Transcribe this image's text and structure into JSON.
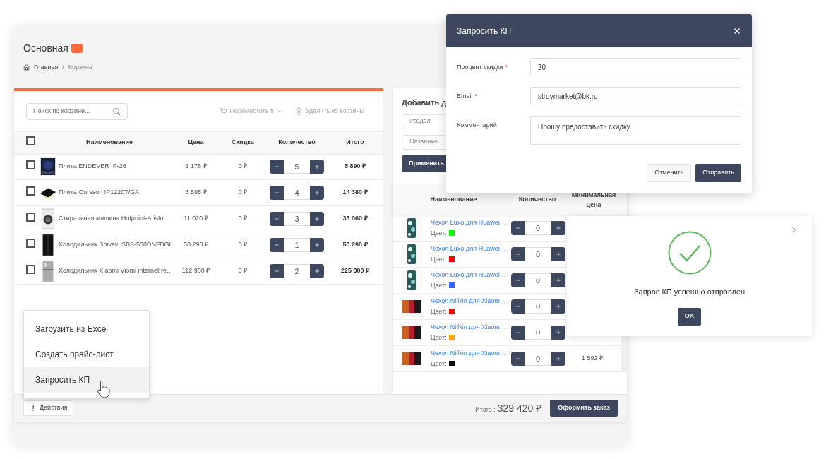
{
  "page": {
    "title": "Основная",
    "breadcrumb": [
      {
        "label": "Главная",
        "kind": "home"
      },
      {
        "label": "/",
        "kind": "separator"
      },
      {
        "label": "Корзина",
        "kind": "current"
      }
    ]
  },
  "cart": {
    "search": {
      "placeholder": "Поиск по корзине..."
    },
    "actions": [
      {
        "label": "Переместить в",
        "kind": "move",
        "disabled": true
      },
      {
        "label": "Удалить из корзины",
        "kind": "delete",
        "disabled": true
      }
    ],
    "select_all": {
      "checked": false
    },
    "columns": [
      "Наименование",
      "Цена",
      "Скидка",
      "Количество",
      "Итого"
    ],
    "rows": [
      {
        "name": "Плита ENDEVER IP-26",
        "price": "1 178 ₽",
        "discount": "0 ₽",
        "qty": "5",
        "total": "5 890 ₽",
        "checked": false
      },
      {
        "name": "Плита Oursson IP1220T/GA",
        "price": "3 595 ₽",
        "discount": "0 ₽",
        "qty": "4",
        "total": "14 380 ₽",
        "checked": false
      },
      {
        "name": "Стиральная машина Hotpoint-Aristo…",
        "price": "11 020 ₽",
        "discount": "0 ₽",
        "qty": "3",
        "total": "33 060 ₽",
        "checked": false
      },
      {
        "name": "Холодильник Shivaki SBS-550DNFBGI",
        "price": "50 290 ₽",
        "discount": "0 ₽",
        "qty": "1",
        "total": "50 290 ₽",
        "checked": false
      },
      {
        "name": "Холодильник Xiaomi Viomi internet re…",
        "price": "112 900 ₽",
        "discount": "0 ₽",
        "qty": "2",
        "total": "225 800 ₽",
        "checked": false
      }
    ]
  },
  "add": {
    "title": "Добавить д",
    "fields": [
      {
        "placeholder": "Раздел"
      },
      {
        "placeholder": "Название"
      }
    ],
    "apply": "Применить",
    "columns": [
      "Наименование",
      "Количество",
      "Минимальная цена"
    ],
    "rows": [
      {
        "name": "Чехол Luxo для Huawei…",
        "color_label": "Цвет:",
        "color": "#00ff00",
        "qty": "0"
      },
      {
        "name": "Чехол Luxo для Huawei…",
        "color_label": "Цвет:",
        "color": "#ff0000",
        "qty": "0"
      },
      {
        "name": "Чехол Luxo для Huawei…",
        "color_label": "Цвет:",
        "color": "#3366ff",
        "qty": "0"
      },
      {
        "name": "Чехол Nillkin для Xiaom…",
        "color_label": "Цвет:",
        "color": "#ff0000",
        "qty": "0"
      },
      {
        "name": "Чехол Nillkin для Xiaom…",
        "color_label": "Цвет:",
        "color": "#ffa500",
        "qty": "0"
      },
      {
        "name": "Чехол Nillkin для Xiaom…",
        "color_label": "Цвет:",
        "color": "#000000",
        "qty": "0",
        "min_price": "1 592 ₽"
      }
    ]
  },
  "footer": {
    "actions": "Действия",
    "total_label": "Итого :",
    "total": "329 420 ₽",
    "checkout": "Оформить заказ"
  },
  "menu": {
    "items": [
      {
        "label": "Загрузить из Excel",
        "selected": false
      },
      {
        "label": "Создать прайс-лист",
        "selected": false
      },
      {
        "label": "Запросить КП",
        "selected": true
      }
    ]
  },
  "modal": {
    "title": "Запросить КП",
    "fields": [
      {
        "label": "Процент скидки",
        "required_mark": "*",
        "value": "20",
        "kind": "input"
      },
      {
        "label": "Email",
        "required_mark": "*",
        "value": "stroymarket@bk.ru",
        "kind": "input"
      },
      {
        "label": "Комментарий",
        "value": "Прошу предоставить скидку",
        "kind": "textarea"
      }
    ],
    "cancel": "Отменить",
    "submit": "Отправить"
  },
  "success": {
    "message": "Запрос КП успешно отправлен",
    "ok": "OK"
  }
}
